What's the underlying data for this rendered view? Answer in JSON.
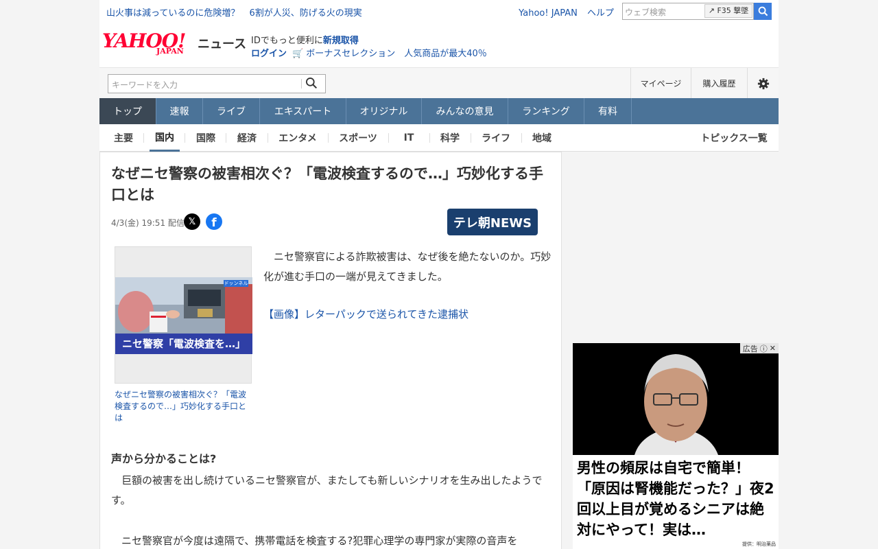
{
  "topbar": {
    "links": [
      "山火事は減っているのに危険増？",
      "6割が人災、防げる火の現実"
    ],
    "right_links": [
      "Yahoo! JAPAN",
      "ヘルプ"
    ],
    "search_placeholder": "ウェブ検索",
    "f35_label": "F35 撃墜"
  },
  "header": {
    "logo": "YAHOO!",
    "logo_sub": "JAPAN",
    "section": "ニュース",
    "promo_line1": "IDでもっと便利に",
    "promo_line1_link": "新規取得",
    "login": "ログイン",
    "bonus_link": "ボーナスセレクション　人気商品が最大40％"
  },
  "searchbar": {
    "placeholder": "キーワードを入力",
    "mypage": "マイページ",
    "history": "購入履歴"
  },
  "gnav": {
    "items": [
      "トップ",
      "速報",
      "ライブ",
      "エキスパート",
      "オリジナル",
      "みんなの意見",
      "ランキング",
      "有料"
    ]
  },
  "cnav": {
    "items": [
      "主要",
      "国内",
      "国際",
      "経済",
      "エンタメ",
      "スポーツ",
      "IT",
      "科学",
      "ライフ",
      "地域"
    ],
    "topics": "トピックス一覧"
  },
  "article": {
    "headline": "なぜニセ警察の被害相次ぐ？「電波検査するので…」巧妙化する手口とは",
    "date": "4/3(金) 19:51 配信",
    "source": "テレ朝NEWS",
    "thumb_overlay": "ニセ警察「電波検査を…」",
    "thumb_tag": "ドッンネル",
    "thumb_caption": "なぜニセ警察の被害相次ぐ？「電波検査するので…」巧妙化する手口とは",
    "lead": "　ニセ警察官による詐欺被害は、なぜ後を絶たないのか。巧妙化が進む手口の一端が見えてきました。",
    "image_link": "【画像】レターパックで送られてきた逮捕状",
    "subhead": "声から分かることは?",
    "para1": "　巨額の被害を出し続けているニセ警察官が、またしても新しいシナリオを生み出したようです。",
    "para2": "　ニセ警察官が今度は遠隔で、携帯電話を検査する?犯罪心理学の専門家が実際の音声を"
  },
  "ad": {
    "label": "広告",
    "text": "男性の頻尿は自宅で簡単！「原因は腎機能だった？」夜2回以上目が覚めるシニアは絶対にやって！実は…",
    "credit": "提供：明治薬品"
  }
}
